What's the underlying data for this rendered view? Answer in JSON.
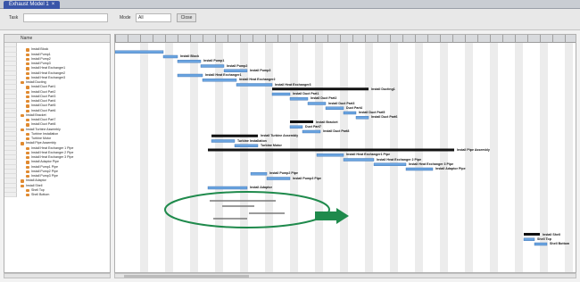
{
  "window": {
    "tab_title": "Exhaust Model 1",
    "close_glyph": "×"
  },
  "toolbar": {
    "task_label": "Task",
    "task_value": "",
    "mode_label": "Mode",
    "mode_value": "All",
    "button_label": "Close"
  },
  "tree": {
    "header": "Name",
    "rows": [
      {
        "label": "",
        "indent": 0,
        "icon": false,
        "selected": true
      },
      {
        "label": "Install Block",
        "indent": 1,
        "icon": true
      },
      {
        "label": "Install Pump1",
        "indent": 1,
        "icon": true
      },
      {
        "label": "Install Pump2",
        "indent": 1,
        "icon": true
      },
      {
        "label": "Install Pump3",
        "indent": 1,
        "icon": true
      },
      {
        "label": "Install Heat Exchanger1",
        "indent": 1,
        "icon": true
      },
      {
        "label": "Install Heat Exchanger2",
        "indent": 1,
        "icon": true
      },
      {
        "label": "Install Heat Exchanger3",
        "indent": 1,
        "icon": true
      },
      {
        "label": "Install Ducting",
        "indent": 0,
        "icon": true
      },
      {
        "label": "Install Duct Part1",
        "indent": 1,
        "icon": true
      },
      {
        "label": "Install Duct Part2",
        "indent": 1,
        "icon": true
      },
      {
        "label": "Install Duct Part3",
        "indent": 1,
        "icon": true
      },
      {
        "label": "Install Duct Part4",
        "indent": 1,
        "icon": true
      },
      {
        "label": "Install Duct Part5",
        "indent": 1,
        "icon": true
      },
      {
        "label": "Install Duct Part6",
        "indent": 1,
        "icon": true
      },
      {
        "label": "Install Bracket",
        "indent": 0,
        "icon": true
      },
      {
        "label": "Install Duct Part7",
        "indent": 1,
        "icon": true
      },
      {
        "label": "Install Duct Part8",
        "indent": 1,
        "icon": true
      },
      {
        "label": "Install Turbine Assembly",
        "indent": 0,
        "icon": true
      },
      {
        "label": "Turbine Installation",
        "indent": 1,
        "icon": true
      },
      {
        "label": "Turbine Motor",
        "indent": 1,
        "icon": true
      },
      {
        "label": "Install Pipe Assembly",
        "indent": 0,
        "icon": true
      },
      {
        "label": "Install Heat Exchanger 1 Pipe",
        "indent": 1,
        "icon": true
      },
      {
        "label": "Install Heat Exchanger 2 Pipe",
        "indent": 1,
        "icon": true
      },
      {
        "label": "Install Heat Exchanger 3 Pipe",
        "indent": 1,
        "icon": true
      },
      {
        "label": "Install Adaptor Pipe",
        "indent": 1,
        "icon": true
      },
      {
        "label": "Install Pump1 Pipe",
        "indent": 1,
        "icon": true
      },
      {
        "label": "Install Pump2 Pipe",
        "indent": 1,
        "icon": true
      },
      {
        "label": "Install Pump3 Pipe",
        "indent": 1,
        "icon": true
      },
      {
        "label": "Install Adaptor",
        "indent": 0,
        "icon": true
      },
      {
        "label": "Install Shell",
        "indent": 0,
        "icon": true
      },
      {
        "label": "Shell Top",
        "indent": 1,
        "icon": true
      },
      {
        "label": "Shell Bottom",
        "indent": 1,
        "icon": true
      }
    ]
  },
  "gantt": {
    "summary_color": "#111111",
    "task_color": "#6aa4e0",
    "annotation_color": "#1f8a4c",
    "bars": [
      {
        "row": 1,
        "start": 0,
        "end": 54,
        "type": "task",
        "label": ""
      },
      {
        "row": 2,
        "start": 54,
        "end": 70,
        "type": "task",
        "label": "Install Block"
      },
      {
        "row": 3,
        "start": 70,
        "end": 96,
        "type": "task",
        "label": "Install Pump1"
      },
      {
        "row": 4,
        "start": 96,
        "end": 122,
        "type": "task",
        "label": "Install Pump2"
      },
      {
        "row": 5,
        "start": 122,
        "end": 148,
        "type": "task",
        "label": "Install Pump3"
      },
      {
        "row": 6,
        "start": 70,
        "end": 98,
        "type": "task",
        "label": "Install Heat Exchanger1"
      },
      {
        "row": 7,
        "start": 98,
        "end": 136,
        "type": "task",
        "label": "Install Heat Exchanger2"
      },
      {
        "row": 8,
        "start": 136,
        "end": 176,
        "type": "task",
        "label": "Install Heat Exchanger3"
      },
      {
        "row": 9,
        "start": 176,
        "end": 284,
        "type": "summary",
        "label": "Install Ducting1"
      },
      {
        "row": 10,
        "start": 176,
        "end": 196,
        "type": "task",
        "label": "Install Duct Part1"
      },
      {
        "row": 11,
        "start": 196,
        "end": 216,
        "type": "task",
        "label": "Install Duct Part2"
      },
      {
        "row": 12,
        "start": 216,
        "end": 236,
        "type": "task",
        "label": "Install Duct Part3"
      },
      {
        "row": 13,
        "start": 236,
        "end": 256,
        "type": "task",
        "label": "Duct Part4"
      },
      {
        "row": 14,
        "start": 256,
        "end": 270,
        "type": "task",
        "label": "Install Duct Part5"
      },
      {
        "row": 15,
        "start": 270,
        "end": 284,
        "type": "task",
        "label": "Install Duct Part6"
      },
      {
        "row": 16,
        "start": 196,
        "end": 222,
        "type": "summary",
        "label": "Install Bracket"
      },
      {
        "row": 17,
        "start": 196,
        "end": 210,
        "type": "task",
        "label": "Duct Part7"
      },
      {
        "row": 18,
        "start": 210,
        "end": 230,
        "type": "task",
        "label": "Install Duct Part8"
      },
      {
        "row": 19,
        "start": 108,
        "end": 160,
        "type": "summary",
        "label": "Install Turbine Assembly"
      },
      {
        "row": 20,
        "start": 108,
        "end": 134,
        "type": "task",
        "label": "Turbine Installation"
      },
      {
        "row": 21,
        "start": 134,
        "end": 160,
        "type": "task",
        "label": "Turbine Motor"
      },
      {
        "row": 22,
        "start": 104,
        "end": 380,
        "type": "summary",
        "label": "Install Pipe Assembly"
      },
      {
        "row": 23,
        "start": 226,
        "end": 256,
        "type": "task",
        "label": "Install Heat Exchanger1 Pipe"
      },
      {
        "row": 24,
        "start": 256,
        "end": 290,
        "type": "task",
        "label": "Install Heat Exchanger 2 Pipe"
      },
      {
        "row": 25,
        "start": 290,
        "end": 326,
        "type": "task",
        "label": "Install Heat Exchanger 3 Pipe"
      },
      {
        "row": 26,
        "start": 326,
        "end": 356,
        "type": "task",
        "label": "Install Adaptor Pipe"
      },
      {
        "row": 27,
        "start": 152,
        "end": 170,
        "type": "task",
        "label": "Install Pump2 Pipe"
      },
      {
        "row": 28,
        "start": 170,
        "end": 196,
        "type": "task",
        "label": "Install Pump3 Pipe"
      },
      {
        "row": 30,
        "start": 104,
        "end": 148,
        "type": "task",
        "label": "Install Adaptor"
      },
      {
        "row": 40,
        "start": 458,
        "end": 476,
        "type": "summary",
        "label": "Install Shell"
      },
      {
        "row": 41,
        "start": 458,
        "end": 470,
        "type": "task",
        "label": "Shell Top"
      },
      {
        "row": 42,
        "start": 470,
        "end": 484,
        "type": "task",
        "label": "Shell Bottom"
      }
    ]
  }
}
